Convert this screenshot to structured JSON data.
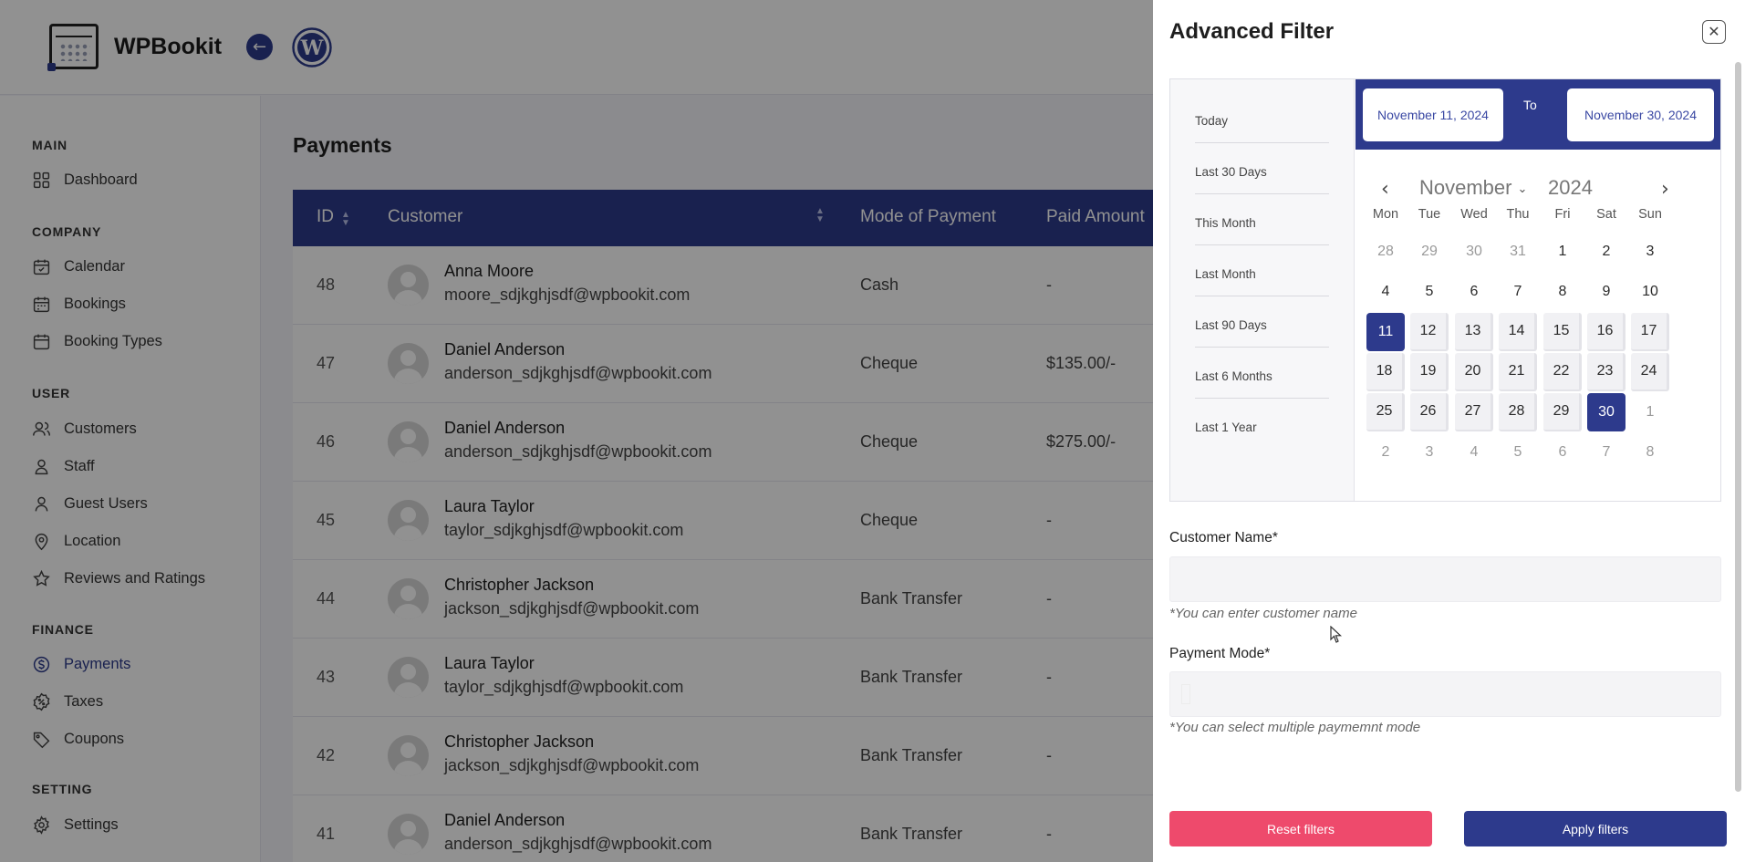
{
  "app": {
    "brand": "WPBookit"
  },
  "sidebar": {
    "sections": [
      {
        "title": "MAIN",
        "items": [
          {
            "label": "Dashboard",
            "icon": "grid-icon"
          }
        ]
      },
      {
        "title": "COMPANY",
        "items": [
          {
            "label": "Calendar",
            "icon": "calendar-icon"
          },
          {
            "label": "Bookings",
            "icon": "bookings-icon"
          },
          {
            "label": "Booking Types",
            "icon": "booking-types-icon"
          }
        ]
      },
      {
        "title": "USER",
        "items": [
          {
            "label": "Customers",
            "icon": "users-icon"
          },
          {
            "label": "Staff",
            "icon": "user-icon"
          },
          {
            "label": "Guest Users",
            "icon": "guest-user-icon"
          },
          {
            "label": "Location",
            "icon": "location-pin-icon"
          },
          {
            "label": "Reviews and Ratings",
            "icon": "star-icon"
          }
        ]
      },
      {
        "title": "FINANCE",
        "items": [
          {
            "label": "Payments",
            "icon": "dollar-circle-icon",
            "active": true
          },
          {
            "label": "Taxes",
            "icon": "percent-badge-icon"
          },
          {
            "label": "Coupons",
            "icon": "tag-icon"
          }
        ]
      },
      {
        "title": "SETTING",
        "items": [
          {
            "label": "Settings",
            "icon": "gear-icon"
          }
        ]
      }
    ]
  },
  "main": {
    "title": "Payments",
    "columns": {
      "id": "ID",
      "customer": "Customer",
      "mode": "Mode of Payment",
      "amount": "Paid Amount"
    },
    "rows": [
      {
        "id": "48",
        "name": "Anna Moore",
        "email": "moore_sdjkghjsdf@wpbookit.com",
        "mode": "Cash",
        "amount": "-"
      },
      {
        "id": "47",
        "name": "Daniel Anderson",
        "email": "anderson_sdjkghjsdf@wpbookit.com",
        "mode": "Cheque",
        "amount": "$135.00/-"
      },
      {
        "id": "46",
        "name": "Daniel Anderson",
        "email": "anderson_sdjkghjsdf@wpbookit.com",
        "mode": "Cheque",
        "amount": "$275.00/-"
      },
      {
        "id": "45",
        "name": "Laura Taylor",
        "email": "taylor_sdjkghjsdf@wpbookit.com",
        "mode": "Cheque",
        "amount": "-"
      },
      {
        "id": "44",
        "name": "Christopher Jackson",
        "email": "jackson_sdjkghjsdf@wpbookit.com",
        "mode": "Bank Transfer",
        "amount": "-"
      },
      {
        "id": "43",
        "name": "Laura Taylor",
        "email": "taylor_sdjkghjsdf@wpbookit.com",
        "mode": "Bank Transfer",
        "amount": "-"
      },
      {
        "id": "42",
        "name": "Christopher Jackson",
        "email": "jackson_sdjkghjsdf@wpbookit.com",
        "mode": "Bank Transfer",
        "amount": "-"
      },
      {
        "id": "41",
        "name": "Daniel Anderson",
        "email": "anderson_sdjkghjsdf@wpbookit.com",
        "mode": "Bank Transfer",
        "amount": "-"
      }
    ]
  },
  "filter": {
    "title": "Advanced Filter",
    "presets": [
      "Today",
      "Last 30 Days",
      "This Month",
      "Last Month",
      "Last 90 Days",
      "Last 6 Months",
      "Last 1 Year"
    ],
    "range": {
      "from": "November 11, 2024",
      "to_label": "To",
      "to": "November 30, 2024"
    },
    "calendar": {
      "month": "November",
      "year": "2024",
      "weekdays": [
        "Mon",
        "Tue",
        "Wed",
        "Thu",
        "Fri",
        "Sat",
        "Sun"
      ],
      "weeks": [
        [
          "28",
          "29",
          "30",
          "31",
          "1",
          "2",
          "3"
        ],
        [
          "4",
          "5",
          "6",
          "7",
          "8",
          "9",
          "10"
        ],
        [
          "11",
          "12",
          "13",
          "14",
          "15",
          "16",
          "17"
        ],
        [
          "18",
          "19",
          "20",
          "21",
          "22",
          "23",
          "24"
        ],
        [
          "25",
          "26",
          "27",
          "28",
          "29",
          "30",
          "1"
        ],
        [
          "2",
          "3",
          "4",
          "5",
          "6",
          "7",
          "8"
        ]
      ],
      "selected_start": "11",
      "selected_end": "30"
    },
    "customer_name": {
      "label": "Customer Name*",
      "value": "",
      "hint": "*You can enter customer name"
    },
    "payment_mode": {
      "label": "Payment Mode*",
      "value": "",
      "hint": "*You can select multiple paymemnt mode"
    },
    "buttons": {
      "reset": "Reset filters",
      "apply": "Apply filters"
    }
  },
  "colors": {
    "primary": "#2d3a8c",
    "danger": "#ee4a6c"
  }
}
